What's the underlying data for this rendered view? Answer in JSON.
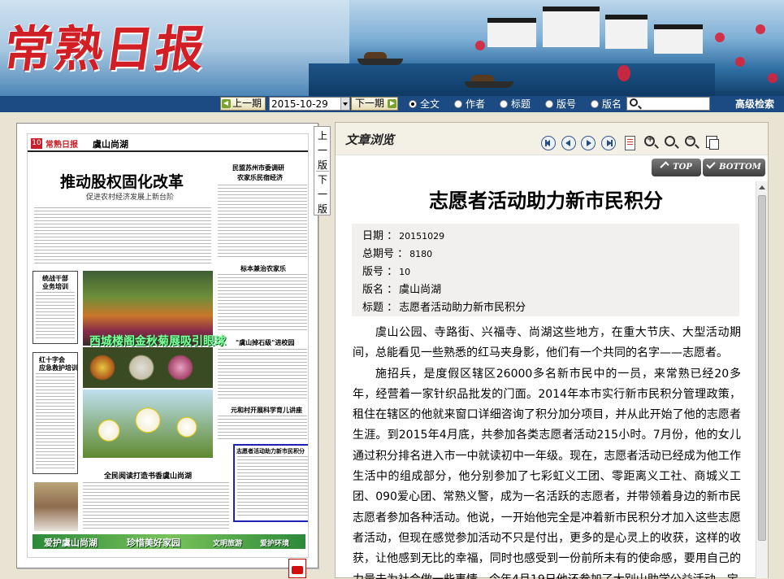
{
  "header": {
    "logo_text": "常熟日报",
    "colors": {
      "toolbar_bg": "#1c4b83",
      "logo_red": "#d21f26"
    }
  },
  "toolbar": {
    "prev_label": "上一期",
    "date_value": "2015-10-29",
    "next_label": "下一期",
    "radios": [
      {
        "label": "全文",
        "checked": true
      },
      {
        "label": "作者",
        "checked": false
      },
      {
        "label": "标题",
        "checked": false
      },
      {
        "label": "版号",
        "checked": false
      },
      {
        "label": "版名",
        "checked": false
      }
    ],
    "search_placeholder": "",
    "advanced_search_label": "高级检索"
  },
  "page_tabs": {
    "prev": "上一版",
    "next": "下一版"
  },
  "newspaper_page": {
    "page_no": "10",
    "masthead": "常熟日报",
    "section": "虞山尚湖",
    "main_title": "推动股权固化改革",
    "main_subtitle": "促进农村经济发展上新台阶",
    "col_titles": [
      "民盟苏州市委调研",
      "农家乐民宿经济",
      "标本兼治农家乐",
      "\"虞山掉石级\"进校园",
      "元和村开展科学育儿讲座",
      "统战干部",
      "业务培训",
      "红十字会",
      "应急救护培训",
      "全民阅读打造书香虞山尚湖"
    ],
    "photo_caption": "西城楼阁金秋菊展吸引眼球",
    "highlight_title": "志愿者活动助力新市民积分",
    "footer_slogans": [
      "爱护虞山尚湖",
      "珍惜美好家园",
      "文明旅游",
      "爱护环境"
    ]
  },
  "article": {
    "panel_label": "文章浏览",
    "toolbar_icons": [
      "first-page-icon",
      "prev-page-icon",
      "next-page-icon",
      "last-page-icon",
      "document-icon",
      "zoom-in-icon",
      "zoom-reset-icon",
      "zoom-out-icon",
      "copy-icon"
    ],
    "top_label": "TOP",
    "bottom_label": "BOTTOM",
    "title": "志愿者活动助力新市民积分",
    "meta": [
      {
        "key": "日期 ：",
        "value": "20151029"
      },
      {
        "key": "总期号 ：",
        "value": "8180"
      },
      {
        "key": "版号 ：",
        "value": "10"
      },
      {
        "key": "版名 ：",
        "value": "虞山尚湖"
      },
      {
        "key": "标题 ：",
        "value": "志愿者活动助力新市民积分"
      }
    ],
    "paragraphs": [
      "虞山公园、寺路街、兴福寺、尚湖这些地方，在重大节庆、大型活动期间，总能看见一些熟悉的红马夹身影，他们有一个共同的名字——志愿者。",
      "施招兵，是度假区辖区26000多名新市民中的一员，来常熟已经20多年，经营着一家针织品批发的门面。2014年本市实行新市民积分管理政策，租住在辖区的他就来窗口详细咨询了积分加分项目，并从此开始了他的志愿者生涯。到2015年4月底，共参加各类志愿者活动215小时。7月份，他的女儿通过积分排名进入市一中就读初中一年级。现在，志愿者活动已经成为他工作生活中的组成部分，他分别参加了七彩虹义工团、零距离义工社、商城义工团、090爱心团、常熟义警，成为一名活跃的志愿者，并带领着身边的新市民志愿者参加各种活动。他说，一开始他完全是冲着新市民积分才加入这些志愿者活动，但现在感觉参加活动不只是付出，更多的是心灵上的收获，这样的收获，让他感到无比的幸福，同时也感受到一份前所未有的使命感，要用自己的力量去为社会做一些事情。今年4月19日他还参加了大别山助学公益活动，宝"
    ]
  }
}
